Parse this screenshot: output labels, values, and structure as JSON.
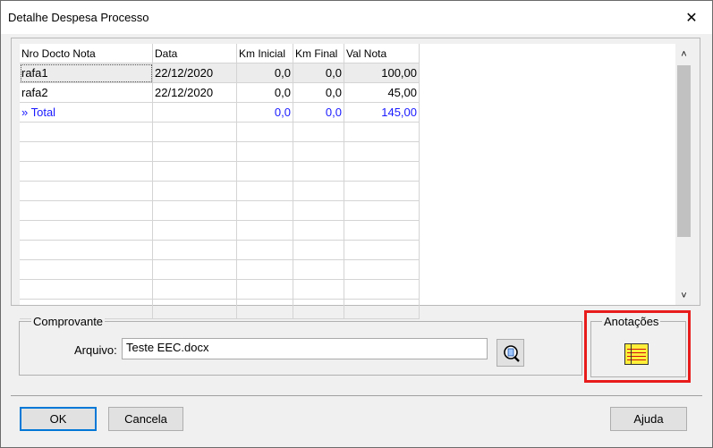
{
  "window": {
    "title": "Detalhe Despesa Processo",
    "close_glyph": "✕"
  },
  "grid": {
    "columns": [
      "Nro Docto Nota",
      "Data",
      "Km Inicial",
      "Km Final",
      "Val Nota"
    ],
    "rows": [
      [
        "rafa1",
        "22/12/2020",
        "0,0",
        "0,0",
        "100,00"
      ],
      [
        "rafa2",
        "22/12/2020",
        "0,0",
        "0,0",
        "45,00"
      ]
    ],
    "total": [
      "» Total",
      "",
      "0,0",
      "0,0",
      "145,00"
    ],
    "scroll_up": "˄",
    "scroll_down": "˅"
  },
  "comprovante": {
    "legend": "Comprovante",
    "arquivo_label": "Arquivo:",
    "arquivo_value": "Teste EEC.docx"
  },
  "anotacoes": {
    "legend": "Anotações"
  },
  "buttons": {
    "ok": "OK",
    "cancela": "Cancela",
    "ajuda": "Ajuda"
  },
  "colors": {
    "total_text": "#1a1aff",
    "highlight_border": "#e81c1c",
    "default_button_border": "#0078d7"
  },
  "icons": {
    "close": "close-icon",
    "search": "magnifier-document-icon",
    "notes": "notes-icon"
  }
}
